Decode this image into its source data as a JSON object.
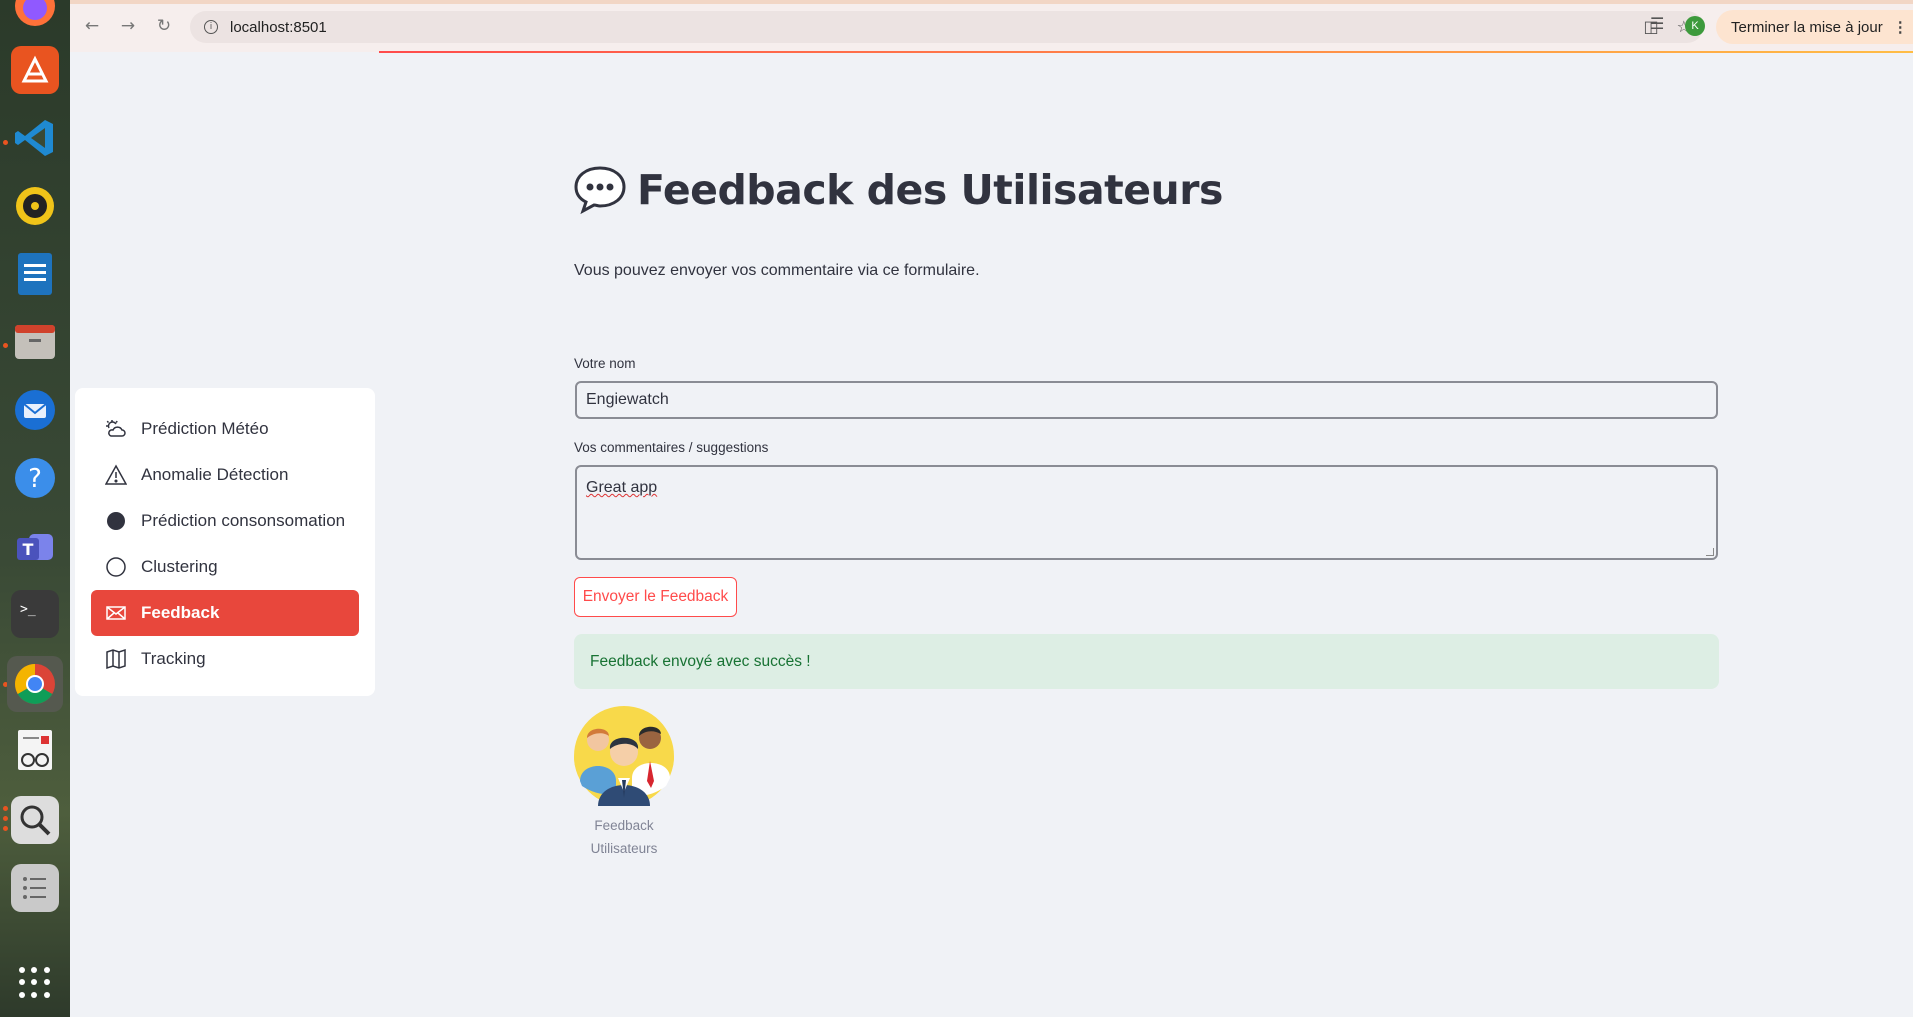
{
  "browser": {
    "url": "localhost:8501",
    "update_button": "Terminer la mise à jour",
    "profile_initial": "K"
  },
  "dock": {
    "items": [
      "firefox-icon",
      "ubuntu-software-icon",
      "vscode-icon",
      "rhythmbox-icon",
      "writer-icon",
      "files-icon",
      "thunderbird-icon",
      "help-icon",
      "teams-icon",
      "terminal-icon",
      "chrome-icon",
      "document-viewer-icon",
      "search-icon",
      "text-editor-icon",
      "apps-grid-icon"
    ]
  },
  "sidebar": {
    "items": [
      {
        "label": "Prédiction Météo",
        "icon": "cloud-sun-icon",
        "active": false
      },
      {
        "label": "Anomalie Détection",
        "icon": "warning-triangle-icon",
        "active": false
      },
      {
        "label": "Prédiction consonsomation",
        "icon": "lightning-circle-icon",
        "active": false
      },
      {
        "label": "Clustering",
        "icon": "circle-icon",
        "active": false
      },
      {
        "label": "Feedback",
        "icon": "envelope-icon",
        "active": true
      },
      {
        "label": "Tracking",
        "icon": "map-icon",
        "active": false
      }
    ],
    "accent_color": "#e8473c"
  },
  "main": {
    "title": "Feedback des Utilisateurs",
    "title_icon": "speech-bubble-icon",
    "intro": "Vous pouvez envoyer vos commentaire via ce formulaire.",
    "name_label": "Votre nom",
    "name_value": "Engiewatch",
    "comments_label": "Vos commentaires / suggestions",
    "comments_value": "Great app",
    "submit_label": "Envoyer le Feedback",
    "success_message": "Feedback envoyé avec succès !",
    "image_caption_line1": "Feedback",
    "image_caption_line2": "Utilisateurs"
  }
}
